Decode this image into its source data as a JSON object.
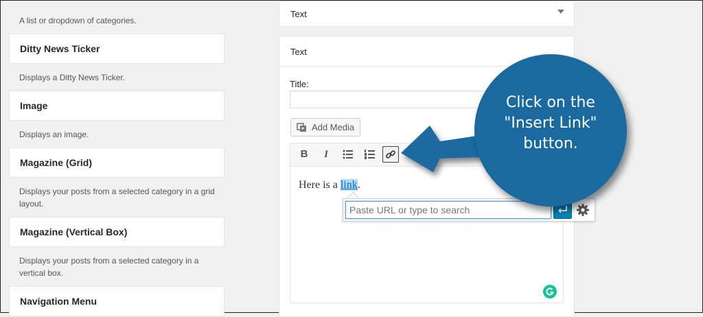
{
  "sidebar": {
    "items": [
      {
        "desc": "A list or dropdown of categories."
      },
      {
        "title": "Ditty News Ticker",
        "desc": "Displays a Ditty News Ticker."
      },
      {
        "title": "Image",
        "desc": "Displays an image."
      },
      {
        "title": "Magazine (Grid)",
        "desc": "Displays your posts from a selected category in a grid layout."
      },
      {
        "title": "Magazine (Vertical Box)",
        "desc": "Displays your posts from a selected category in a vertical box."
      },
      {
        "title": "Navigation Menu"
      }
    ]
  },
  "panel_top": {
    "title": "Text"
  },
  "panel_main": {
    "title": "Text",
    "title_label": "Title:",
    "title_value": "",
    "add_media_label": "Add Media",
    "toolbar": {
      "bold": "B",
      "italic": "I"
    },
    "editor": {
      "text_before": "Here is a ",
      "link_text": "link",
      "text_after": "."
    },
    "link_popup": {
      "placeholder": "Paste URL or type to search"
    }
  },
  "callout": {
    "line1": "Click on the",
    "line2": "\"Insert Link\"",
    "line3": "button."
  },
  "colors": {
    "callout": "#1a6aa0",
    "apply_button": "#0085ba",
    "grammarly": "#15c39a"
  }
}
